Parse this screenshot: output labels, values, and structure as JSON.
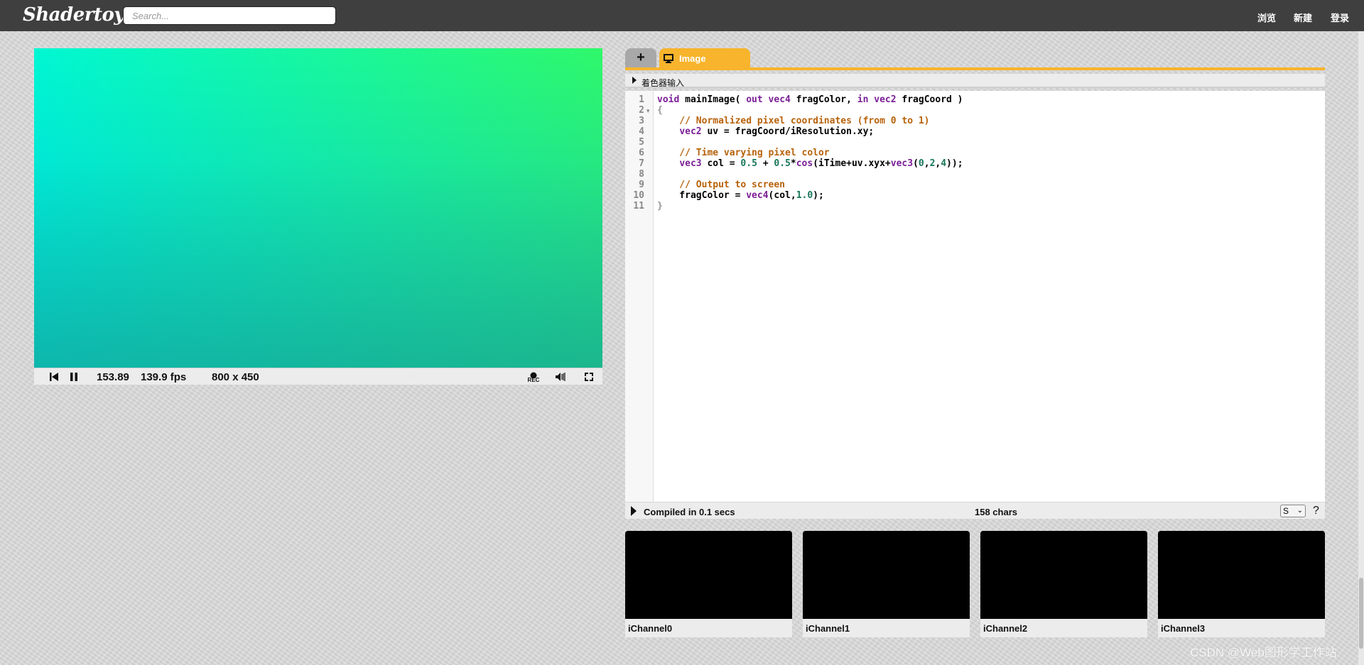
{
  "header": {
    "logo": "Shadertoy",
    "search_placeholder": "Search...",
    "nav": {
      "browse": "浏览",
      "new": "新建",
      "login": "登录"
    }
  },
  "player": {
    "time": "153.89",
    "fps": "139.9 fps",
    "resolution": "800 x 450",
    "rec_label": "REC",
    "icons": [
      "rewind-icon",
      "pause-icon",
      "record-icon",
      "volume-icon",
      "fullscreen-icon"
    ]
  },
  "editor": {
    "add_tab_label": "+",
    "tab_label": "Image",
    "inputs_header": "着色器输入",
    "line_numbers": [
      "1",
      "2",
      "3",
      "4",
      "5",
      "6",
      "7",
      "8",
      "9",
      "10",
      "11"
    ],
    "code_lines": [
      "void mainImage( out vec4 fragColor, in vec2 fragCoord )",
      "{",
      "    // Normalized pixel coordinates (from 0 to 1)",
      "    vec2 uv = fragCoord/iResolution.xy;",
      "",
      "    // Time varying pixel color",
      "    vec3 col = 0.5 + 0.5*cos(iTime+uv.xyx+vec3(0,2,4));",
      "",
      "    // Output to screen",
      "    fragColor = vec4(col,1.0);",
      "}"
    ],
    "status_compiled": "Compiled in 0.1 secs",
    "status_chars": "158 chars",
    "font_size_value": "S",
    "help_label": "?"
  },
  "channels": [
    {
      "label": "iChannel0"
    },
    {
      "label": "iChannel1"
    },
    {
      "label": "iChannel2"
    },
    {
      "label": "iChannel3"
    }
  ],
  "watermark": "CSDN @Web图形学工作站",
  "colors": {
    "accent": "#f7b42c",
    "header_bg": "#3f3f3f",
    "keyword": "#7b1f96",
    "comment": "#b8620a",
    "number": "#17755a"
  }
}
